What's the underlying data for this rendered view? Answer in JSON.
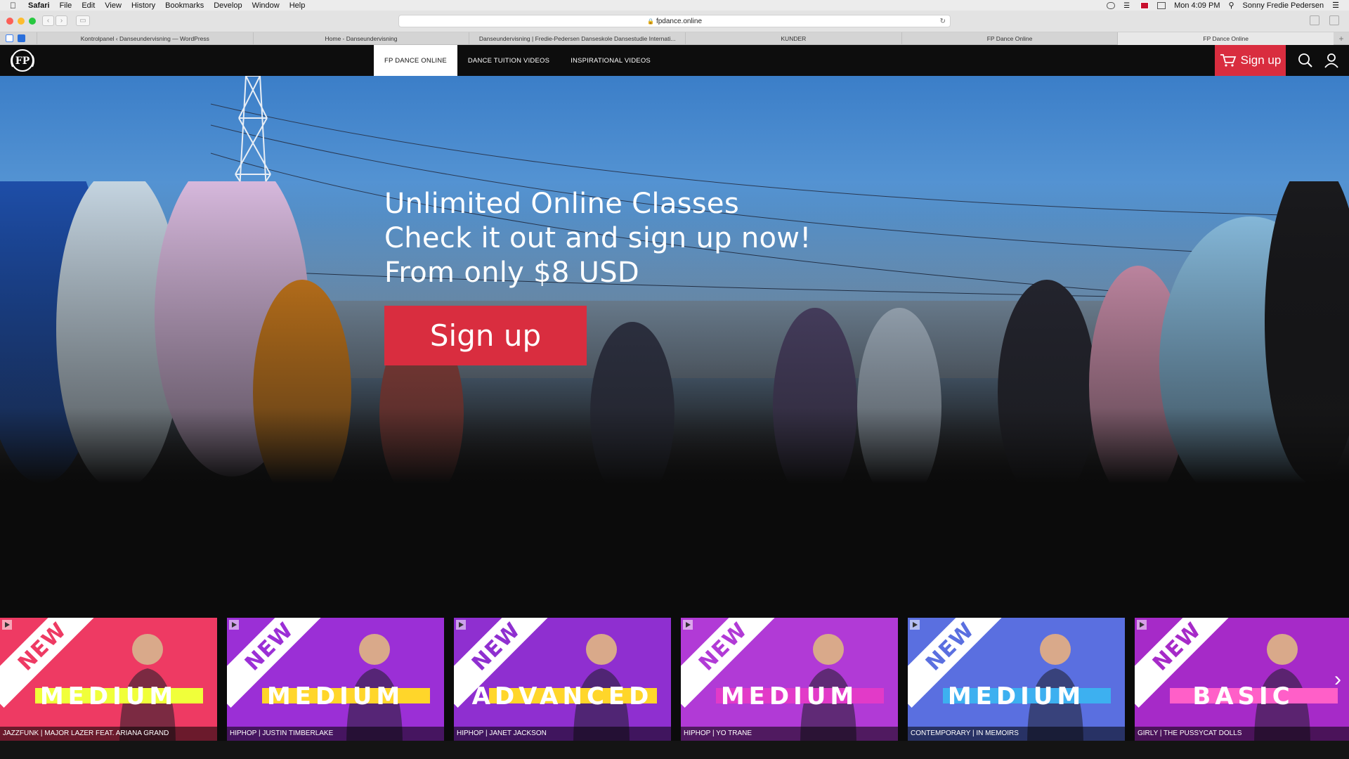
{
  "menubar": {
    "app": "Safari",
    "items": [
      "File",
      "Edit",
      "View",
      "History",
      "Bookmarks",
      "Develop",
      "Window",
      "Help"
    ],
    "clock": "Mon 4:09 PM",
    "user": "Sonny Fredie Pedersen"
  },
  "browser": {
    "url": "fpdance.online",
    "tabs": [
      "Kontrolpanel ‹ Danseundervisning — WordPress",
      "Home - Danseundervisning",
      "Danseundervisning | Fredie-Pedersen Danseskole Dansestudie Internati...",
      "KUNDER",
      "FP Dance Online",
      "FP Dance Online"
    ]
  },
  "site": {
    "nav": [
      "FP DANCE ONLINE",
      "DANCE TUITION VIDEOS",
      "INSPIRATIONAL VIDEOS"
    ],
    "header_signup": "Sign up"
  },
  "hero": {
    "line1": "Unlimited Online Classes",
    "line2": "Check it out and sign up now!",
    "line3": "From only $8 USD",
    "cta": "Sign up"
  },
  "thumbnails": [
    {
      "badge": "NEW",
      "level": "MEDIUM",
      "caption": "JAZZFUNK | MAJOR LAZER FEAT. ARIANA GRAND",
      "bg": "#ee3a63",
      "band": "#f0ff3a",
      "badge_color": "#ee3a63"
    },
    {
      "badge": "NEW",
      "level": "MEDIUM",
      "caption": "HIPHOP | JUSTIN TIMBERLAKE",
      "bg": "#9b2fd6",
      "band": "#ffd62a",
      "badge_color": "#9b2fd6"
    },
    {
      "badge": "NEW",
      "level": "ADVANCED",
      "caption": "HIPHOP | JANET JACKSON",
      "bg": "#8f2fd0",
      "band": "#ffd62a",
      "badge_color": "#8f2fd0"
    },
    {
      "badge": "NEW",
      "level": "MEDIUM",
      "caption": "HIPHOP | YO TRANE",
      "bg": "#b13ad6",
      "band": "#e23ac8",
      "badge_color": "#b13ad6"
    },
    {
      "badge": "NEW",
      "level": "MEDIUM",
      "caption": "CONTEMPORARY | IN MEMOIRS",
      "bg": "#5a6fe0",
      "band": "#3db0f0",
      "badge_color": "#5a6fe0"
    },
    {
      "badge": "NEW",
      "level": "BASIC",
      "caption": "GIRLY | THE PUSSYCAT DOLLS",
      "bg": "#a62ac8",
      "band": "#ff5fc8",
      "badge_color": "#a62ac8"
    }
  ],
  "colors": {
    "accent": "#d92d3f",
    "header_bg": "#0d0d0d"
  }
}
